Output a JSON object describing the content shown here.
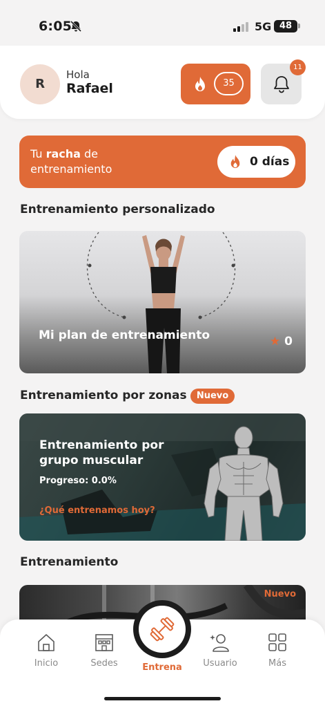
{
  "status_bar": {
    "time": "6:05",
    "network": "5G",
    "battery": "48"
  },
  "header": {
    "avatar_initial": "R",
    "greeting": "Hola",
    "user_name": "Rafael",
    "points": "35",
    "notification_count": "11"
  },
  "streak": {
    "prefix": "Tu ",
    "highlight": "racha",
    "suffix": " de entrenamiento",
    "days": "0 días"
  },
  "sections": {
    "personalized": "Entrenamiento personalizado",
    "zones": "Entrenamiento por zonas",
    "zones_badge": "Nuevo",
    "training": "Entrenamiento"
  },
  "plan_card": {
    "title": "Mi plan de entrenamiento",
    "rating": "0"
  },
  "zones_card": {
    "title": "Entrenamiento por grupo muscular",
    "progress": "Progreso: 0.0%",
    "link": "¿Qué entrenamos hoy?"
  },
  "training_card": {
    "badge": "Nuevo"
  },
  "tabbar": {
    "items": [
      {
        "label": "Inicio",
        "icon": "home-icon"
      },
      {
        "label": "Sedes",
        "icon": "building-icon"
      },
      {
        "label": "Entrena",
        "icon": "dumbbell-icon"
      },
      {
        "label": "Usuario",
        "icon": "user-icon"
      },
      {
        "label": "Más",
        "icon": "grid-icon"
      }
    ]
  },
  "colors": {
    "accent": "#e06a37",
    "background": "#f4f3f3"
  }
}
